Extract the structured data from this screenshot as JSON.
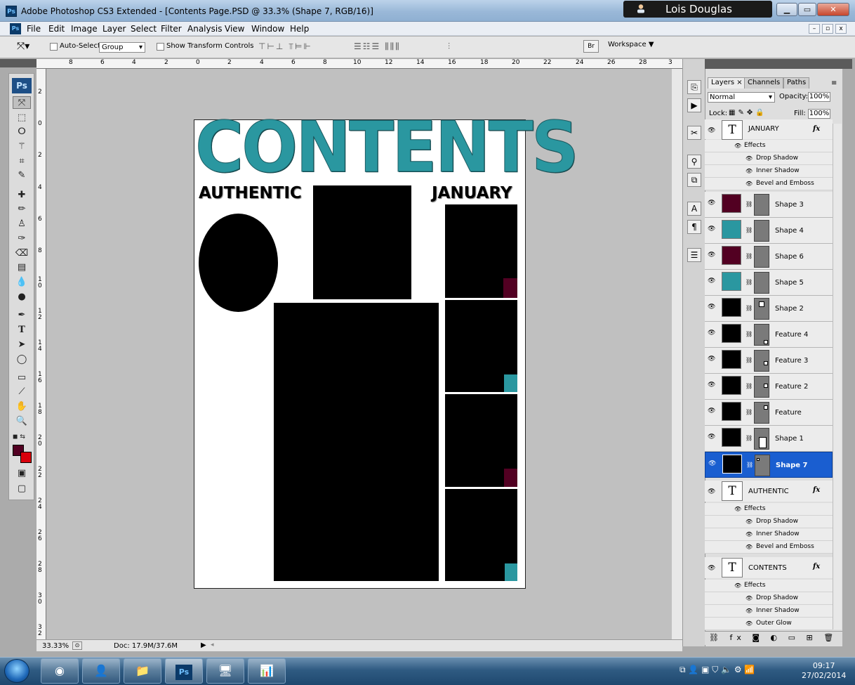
{
  "window": {
    "title": "Adobe Photoshop CS3 Extended - [Contents Page.PSD @ 33.3% (Shape 7, RGB/16)]",
    "app_icon": "Ps",
    "user": "Lois Douglas"
  },
  "menu": [
    "File",
    "Edit",
    "Image",
    "Layer",
    "Select",
    "Filter",
    "Analysis",
    "View",
    "Window",
    "Help"
  ],
  "options": {
    "auto_select_label": "Auto-Select:",
    "auto_select_value": "Group",
    "transform_label": "Show Transform Controls",
    "workspace_label": "Workspace ▼"
  },
  "ruler_top": [
    "8",
    "6",
    "4",
    "2",
    "0",
    "2",
    "4",
    "6",
    "8",
    "10",
    "12",
    "14",
    "16",
    "18",
    "20",
    "22",
    "24",
    "26",
    "28",
    "3"
  ],
  "ruler_left": [
    "2",
    "0",
    "2",
    "4",
    "6",
    "8",
    "1 0",
    "1 2",
    "1 4",
    "1 6",
    "1 8",
    "2 0",
    "2 2",
    "2 4",
    "2 6",
    "2 8",
    "3 0",
    "3 2"
  ],
  "document": {
    "headline": "CONTENTS",
    "left_label": "AUTHENTIC",
    "right_label": "JANUARY"
  },
  "status": {
    "zoom": "33.33%",
    "doc": "Doc: 17.9M/37.6M"
  },
  "toolbox": {
    "logo": "Ps"
  },
  "layers_panel": {
    "tabs": [
      "Layers ×",
      "Channels",
      "Paths"
    ],
    "blend_mode": "Normal",
    "opacity_label": "Opacity:",
    "opacity": "100%",
    "lock_label": "Lock:",
    "fill_label": "Fill:",
    "fill": "100%",
    "effects_label": "Effects",
    "january_layer": {
      "name": "JANUARY",
      "effects": [
        "Drop Shadow",
        "Inner Shadow",
        "Bevel and Emboss"
      ]
    },
    "shape_layers": [
      {
        "name": "Shape 3",
        "color": "#520022"
      },
      {
        "name": "Shape 4",
        "color": "#2a97a0"
      },
      {
        "name": "Shape 6",
        "color": "#520022"
      },
      {
        "name": "Shape 5",
        "color": "#2a97a0"
      },
      {
        "name": "Shape 2",
        "color": "#000000"
      },
      {
        "name": "Feature 4",
        "color": "#000000"
      },
      {
        "name": "Feature 3",
        "color": "#000000"
      },
      {
        "name": "Feature 2",
        "color": "#000000"
      },
      {
        "name": "Feature",
        "color": "#000000"
      },
      {
        "name": "Shape 1",
        "color": "#000000"
      },
      {
        "name": "Shape 7",
        "color": "#000000"
      }
    ],
    "authentic_layer": {
      "name": "AUTHENTIC",
      "effects": [
        "Drop Shadow",
        "Inner Shadow",
        "Bevel and Emboss"
      ]
    },
    "contents_layer": {
      "name": "CONTENTS",
      "effects": [
        "Drop Shadow",
        "Inner Shadow",
        "Outer Glow"
      ]
    }
  },
  "taskbar": {
    "time": "09:17",
    "date": "27/02/2014",
    "ps_button": "Ps"
  },
  "colors": {
    "teal": "#2a97a0",
    "maroon": "#520022",
    "selection": "#1a5ed0"
  }
}
